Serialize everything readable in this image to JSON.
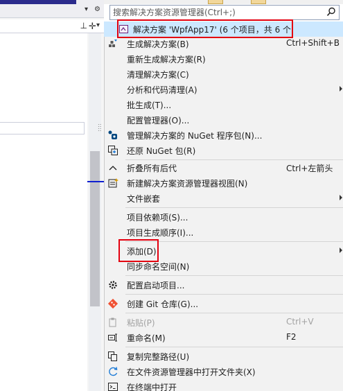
{
  "search": {
    "placeholder": "搜索解决方案资源管理器(Ctrl+;)"
  },
  "solution": {
    "label": "解决方案 'WpfApp17' (6 个项目，共 6 个"
  },
  "menu": {
    "build_solution": {
      "label": "生成解决方案(B)",
      "shortcut": "Ctrl+Shift+B"
    },
    "rebuild_solution": {
      "label": "重新生成解决方案(R)"
    },
    "clean_solution": {
      "label": "清理解决方案(C)"
    },
    "analyze_cleanup": {
      "label": "分析和代码清理(A)"
    },
    "batch_build": {
      "label": "批生成(T)..."
    },
    "config_manager": {
      "label": "配置管理器(O)..."
    },
    "manage_nuget": {
      "label": "管理解决方案的 NuGet 程序包(N)..."
    },
    "restore_nuget": {
      "label": "还原 NuGet 包(R)"
    },
    "collapse_all": {
      "label": "折叠所有后代",
      "shortcut": "Ctrl+左箭头"
    },
    "new_view": {
      "label": "新建解决方案资源管理器视图(N)"
    },
    "file_nesting": {
      "label": "文件嵌套"
    },
    "project_deps": {
      "label": "项目依赖项(S)..."
    },
    "build_order": {
      "label": "项目生成顺序(I)..."
    },
    "add": {
      "label": "添加(D)"
    },
    "sync_namespaces": {
      "label": "同步命名空间(N)"
    },
    "startup_projects": {
      "label": "配置启动项目..."
    },
    "create_git": {
      "label": "创建 Git 仓库(G)..."
    },
    "paste": {
      "label": "粘贴(P)",
      "shortcut": "Ctrl+V"
    },
    "rename": {
      "label": "重命名(M)",
      "shortcut": "F2"
    },
    "copy_full_path": {
      "label": "复制完整路径(U)"
    },
    "open_in_explorer": {
      "label": "在文件资源管理器中打开文件夹(X)"
    },
    "open_in_terminal": {
      "label": "在终端中打开"
    }
  },
  "colors": {
    "highlight": "#cce8ff",
    "annotation": "#e3000f",
    "menu_bg": "#f2f2f2"
  }
}
